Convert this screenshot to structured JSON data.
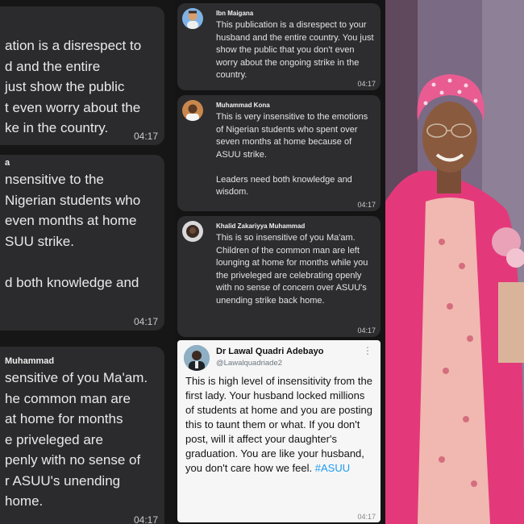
{
  "left": {
    "b1": {
      "lines": [
        "ation is a disrespect to",
        "d and the entire",
        "just show the public",
        "t even worry about the",
        "ke in the country."
      ],
      "time": "04:17"
    },
    "b2": {
      "name": "a",
      "lines": [
        "nsensitive to the",
        "Nigerian students who",
        "even months at home",
        "SUU strike.",
        "",
        "d both knowledge and"
      ],
      "time": "04:17"
    },
    "b3": {
      "name": "Muhammad",
      "lines": [
        "sensitive of you Ma'am.",
        "he common man are",
        "at home for months",
        "e priveleged are",
        "penly with no sense of",
        "r ASUU's unending",
        "home."
      ],
      "time": "04:17"
    }
  },
  "comments": [
    {
      "name": "Ibn Maigana",
      "text": "This publication is a disrespect to your husband and the entire country. You just show the public that you don't even worry about the ongoing strike in the country.",
      "time": "04:17"
    },
    {
      "name": "Muhammad Kona",
      "text": "This is very insensitive to the emotions of Nigerian students who spent over seven months at home because of ASUU strike.",
      "text2": "Leaders need both knowledge and wisdom.",
      "time": "04:17"
    },
    {
      "name": "Khalid Zakariyya Muhammad",
      "text": "This is so insensitive of you Ma'am. Children of the common man are left lounging at home for months while you the priveleged are celebrating openly with no sense of concern over ASUU's unending strike back home.",
      "time": "04:17"
    }
  ],
  "tweet": {
    "name": "Dr Lawal Quadri Adebayo",
    "handle": "@Lawalquadriade2",
    "more": "⋮",
    "text": "This is high level of insensitivity from the first lady. Your husband locked millions of students at home and you are posting this to taunt them or what. If you don't post, will it affect your daughter's graduation. You are like your husband, you don't care how we feel.",
    "hashtag": "#ASUU",
    "time": "04:17"
  },
  "colors": {
    "bubble": "#2b2b2d",
    "card": "#2d2d2f",
    "hashtag": "#1d9bf0",
    "headwrap": "#e85c92",
    "shawl": "#e3397a"
  }
}
